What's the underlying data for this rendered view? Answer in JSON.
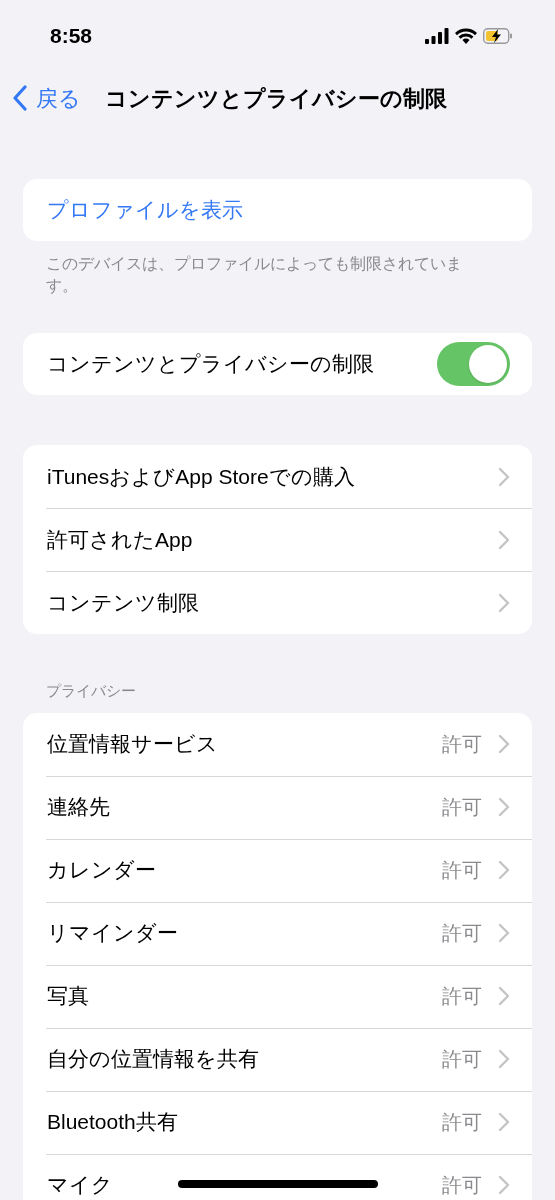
{
  "status_bar": {
    "time": "8:58"
  },
  "nav": {
    "back": "戻る",
    "title": "コンテンツとプライバシーの制限"
  },
  "profile": {
    "link": "プロファイルを表示",
    "footer": "このデバイスは、プロファイルによっても制限されています。"
  },
  "restriction_toggle": {
    "label": "コンテンツとプライバシーの制限",
    "on": true
  },
  "menu": [
    {
      "label": "iTunesおよびApp Storeでの購入"
    },
    {
      "label": "許可されたApp"
    },
    {
      "label": "コンテンツ制限"
    }
  ],
  "privacy": {
    "header": "プライバシー",
    "items": [
      {
        "label": "位置情報サービス",
        "value": "許可"
      },
      {
        "label": "連絡先",
        "value": "許可"
      },
      {
        "label": "カレンダー",
        "value": "許可"
      },
      {
        "label": "リマインダー",
        "value": "許可"
      },
      {
        "label": "写真",
        "value": "許可"
      },
      {
        "label": "自分の位置情報を共有",
        "value": "許可"
      },
      {
        "label": "Bluetooth共有",
        "value": "許可"
      },
      {
        "label": "マイク",
        "value": "許可"
      }
    ]
  }
}
